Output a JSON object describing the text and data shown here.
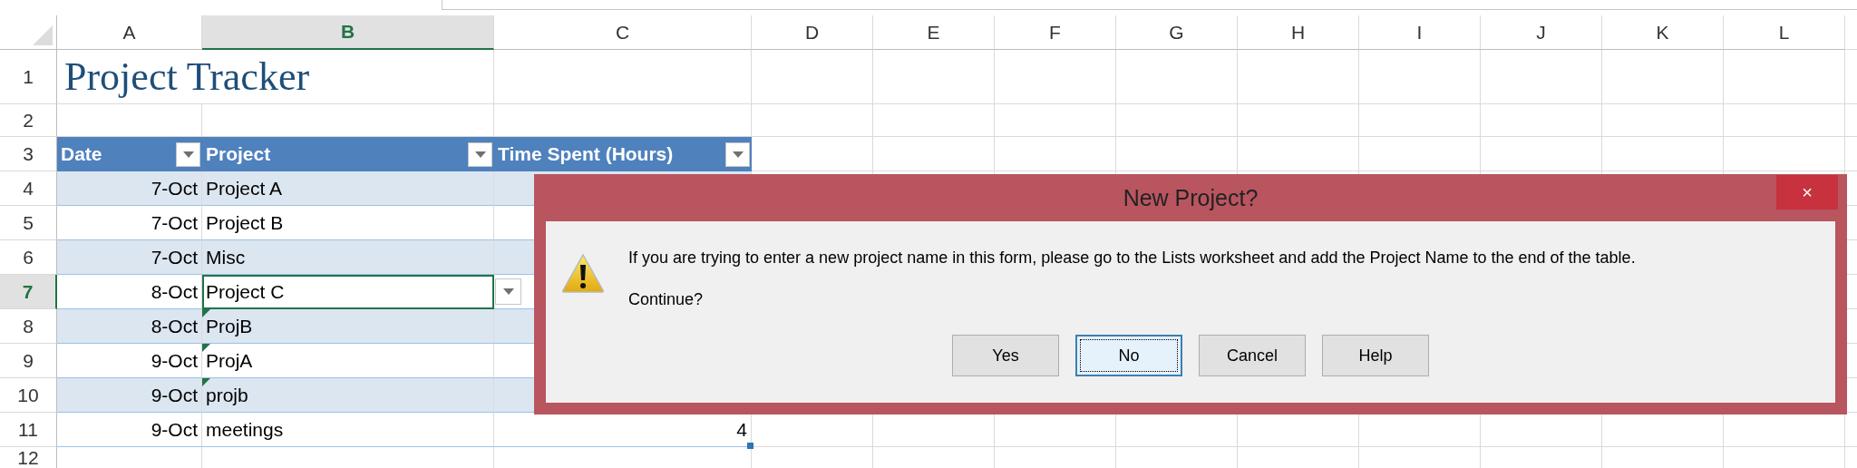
{
  "column_headers": [
    {
      "label": "A",
      "selected": false
    },
    {
      "label": "B",
      "selected": true
    },
    {
      "label": "C",
      "selected": false
    },
    {
      "label": "D",
      "selected": false
    },
    {
      "label": "E",
      "selected": false
    },
    {
      "label": "F",
      "selected": false
    },
    {
      "label": "G",
      "selected": false
    },
    {
      "label": "H",
      "selected": false
    },
    {
      "label": "I",
      "selected": false
    },
    {
      "label": "J",
      "selected": false
    },
    {
      "label": "K",
      "selected": false
    },
    {
      "label": "L",
      "selected": false
    }
  ],
  "row_headers": [
    {
      "label": "1",
      "selected": false
    },
    {
      "label": "2",
      "selected": false
    },
    {
      "label": "3",
      "selected": false
    },
    {
      "label": "4",
      "selected": false
    },
    {
      "label": "5",
      "selected": false
    },
    {
      "label": "6",
      "selected": false
    },
    {
      "label": "7",
      "selected": true
    },
    {
      "label": "8",
      "selected": false
    },
    {
      "label": "9",
      "selected": false
    },
    {
      "label": "10",
      "selected": false
    },
    {
      "label": "11",
      "selected": false
    },
    {
      "label": "12",
      "selected": false
    }
  ],
  "title": "Project Tracker",
  "table": {
    "columns": [
      {
        "label": "Date"
      },
      {
        "label": "Project"
      },
      {
        "label": "Time Spent (Hours)"
      }
    ],
    "rows": [
      {
        "date": "7-Oct",
        "project": "Project A",
        "selected": false,
        "error_indicator": false
      },
      {
        "date": "7-Oct",
        "project": "Project B",
        "selected": false,
        "error_indicator": false
      },
      {
        "date": "7-Oct",
        "project": "Misc",
        "selected": false,
        "error_indicator": false
      },
      {
        "date": "8-Oct",
        "project": "Project C",
        "selected": true,
        "error_indicator": false
      },
      {
        "date": "8-Oct",
        "project": "ProjB",
        "selected": false,
        "error_indicator": true
      },
      {
        "date": "9-Oct",
        "project": "ProjA",
        "selected": false,
        "error_indicator": true
      },
      {
        "date": "9-Oct",
        "project": "projb",
        "selected": false,
        "error_indicator": true
      },
      {
        "date": "9-Oct",
        "project": "meetings",
        "time": "4",
        "selected": false,
        "error_indicator": false
      }
    ]
  },
  "dialog": {
    "title": "New Project?",
    "close": "×",
    "message": "If you are trying to enter a new project name in this form, please go to the Lists worksheet and add the Project Name to the end of the table.",
    "question": "Continue?",
    "buttons": [
      {
        "label": "Yes",
        "default": false
      },
      {
        "label": "No",
        "default": true
      },
      {
        "label": "Cancel",
        "default": false
      },
      {
        "label": "Help",
        "default": false
      }
    ]
  }
}
